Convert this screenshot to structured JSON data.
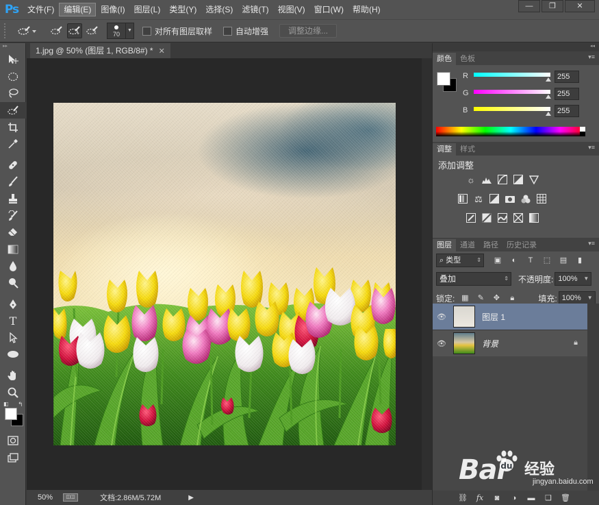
{
  "app": {
    "logo": "Ps"
  },
  "menu": [
    "文件(F)",
    "编辑(E)",
    "图像(I)",
    "图层(L)",
    "类型(Y)",
    "选择(S)",
    "滤镜(T)",
    "视图(V)",
    "窗口(W)",
    "帮助(H)"
  ],
  "active_menu": "编辑(E)",
  "window_controls": {
    "minimize": "—",
    "restore": "❐",
    "close": "✕"
  },
  "options": {
    "brush_size": "70",
    "sample_all_label": "对所有图层取样",
    "auto_enhance_label": "自动增强",
    "refine_edge_label": "调整边缘..."
  },
  "document": {
    "tab_title": "1.jpg @ 50% (图层 1, RGB/8#) *",
    "zoom": "50%",
    "doc_info": "文档:2.86M/5.72M"
  },
  "color_panel": {
    "tabs": [
      "颜色",
      "色板"
    ],
    "channels": [
      {
        "label": "R",
        "value": "255",
        "color": "#00e5ff"
      },
      {
        "label": "G",
        "value": "255",
        "color": "#e400e4"
      },
      {
        "label": "B",
        "value": "255",
        "color": "#f6f600"
      }
    ]
  },
  "adjust_panel": {
    "tabs": [
      "调整",
      "样式"
    ],
    "title": "添加调整"
  },
  "layers_panel": {
    "tabs": [
      "图层",
      "通道",
      "路径",
      "历史记录"
    ],
    "kind": "类型",
    "blend_mode": "叠加",
    "opacity_label": "不透明度:",
    "opacity": "100%",
    "lock_label": "锁定:",
    "fill_label": "填充:",
    "fill": "100%",
    "layers": [
      {
        "name": "图层 1",
        "selected": true
      },
      {
        "name": "背景",
        "selected": false,
        "locked": true
      }
    ]
  },
  "watermark": {
    "brand": "Bai",
    "suffix": "经验",
    "url": "jingyan.baidu.com"
  }
}
